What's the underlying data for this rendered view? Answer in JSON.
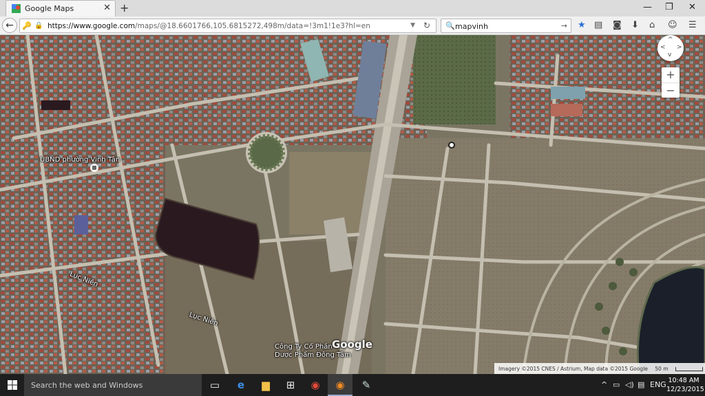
{
  "browser": {
    "tab_title": "Google Maps",
    "url_host": "https://www.google.com",
    "url_path": "/maps/@18.6601766,105.6815272,498m/data=!3m1!1e3?hl=en",
    "search_value": "mapvinh",
    "icons": [
      "back-icon",
      "site-info-icon",
      "lock-icon",
      "reload-icon",
      "search-icon",
      "bookmark-star-icon",
      "clipboard-icon",
      "pocket-icon",
      "download-icon",
      "home-icon",
      "chat-icon",
      "menu-icon"
    ]
  },
  "map": {
    "labels": {
      "ubnd": "UBND phường Vinh Tân",
      "road1": "Lục Niên",
      "road2": "Lục Niên",
      "company_line1": "Công Ty Cổ Phần",
      "company_line2": "Dược Phẩm Đông Tâm"
    },
    "logo": "Google",
    "attribution": "Imagery ©2015 CNES / Astrium, Map data ©2015 Google",
    "scale": "50 m",
    "zoom_in": "+",
    "zoom_out": "−"
  },
  "taskbar": {
    "search_placeholder": "Search the web and Windows",
    "language": "ENG",
    "time": "10:48 AM",
    "date": "12/23/2015"
  },
  "colors": {
    "land": "#7a7562",
    "road": "#c4bfb0",
    "pond": "#2a1a20",
    "lake": "#1b1f2a"
  }
}
